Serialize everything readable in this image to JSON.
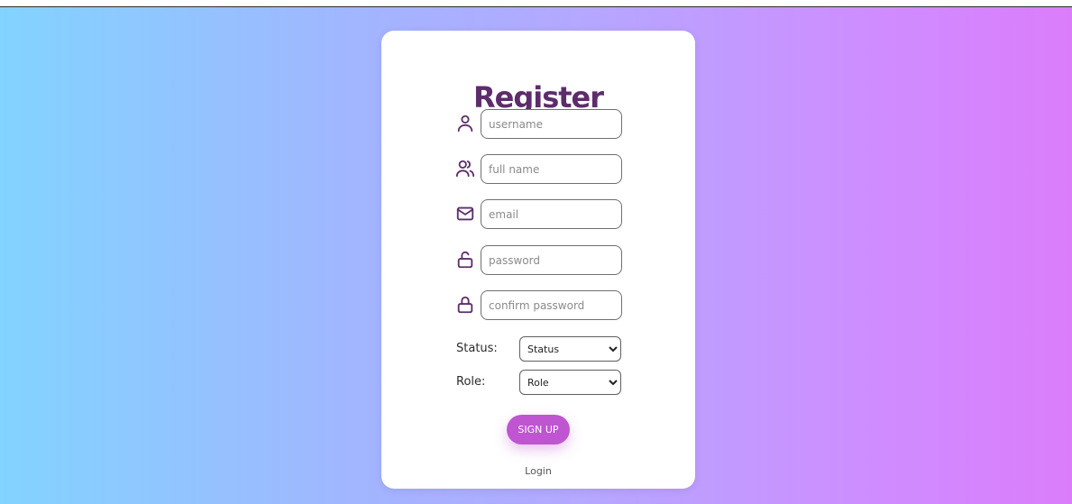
{
  "page": {
    "title": "Register"
  },
  "form": {
    "username": {
      "placeholder": "username",
      "value": ""
    },
    "full_name": {
      "placeholder": "full name",
      "value": ""
    },
    "email": {
      "placeholder": "email",
      "value": ""
    },
    "password": {
      "placeholder": "password",
      "value": ""
    },
    "confirm_password": {
      "placeholder": "confirm password",
      "value": ""
    },
    "status": {
      "label": "Status:",
      "selected": "Status"
    },
    "role": {
      "label": "Role:",
      "selected": "Role"
    },
    "signup_label": "SIGN UP",
    "login_label": "Login"
  },
  "icons": {
    "username": "user-icon",
    "full_name": "users-icon",
    "email": "mail-icon",
    "password": "unlock-icon",
    "confirm_password": "lock-icon"
  },
  "colors": {
    "title": "#5d2d6b",
    "icon": "#5d2d6b",
    "button": "#bf55d1",
    "gradient_left": "#82d3ff",
    "gradient_right": "#db7dfb"
  }
}
